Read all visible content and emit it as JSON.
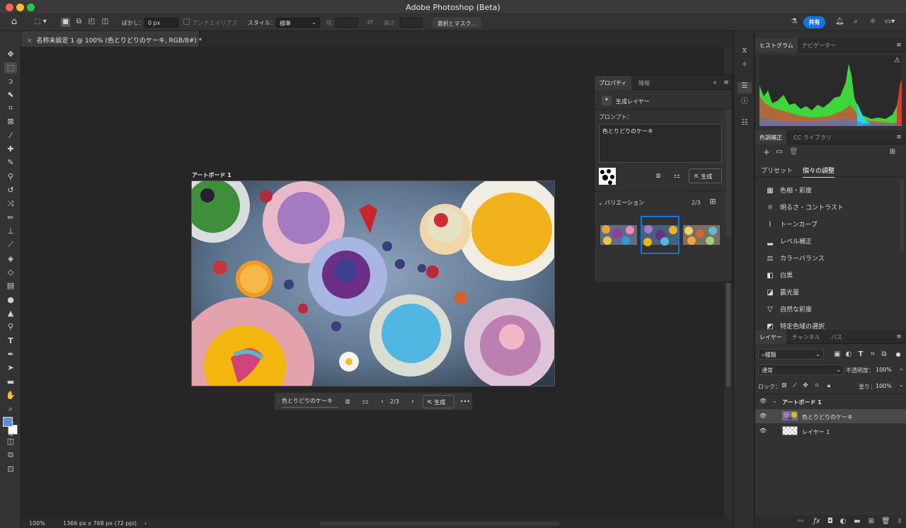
{
  "window": {
    "title": "Adobe Photoshop (Beta)"
  },
  "options_bar": {
    "feather_label": "ぼかし：",
    "feather_value": "0 px",
    "antialias_label": "アンチエイリアス",
    "style_label": "スタイル：",
    "style_value": "標準",
    "width_label": "幅：",
    "height_label": "高さ：",
    "select_mask_button": "選択とマスク...",
    "share_button": "共有"
  },
  "document": {
    "tab_title": "名称未設定 1 @ 100% (色とりどりのケーキ, RGB/8#) *",
    "artboard_label": "アートボード 1"
  },
  "contextual_taskbar": {
    "prompt_text": "色とりどりのケーキ",
    "variation_counter": "2/3",
    "generate_button": "生成",
    "more": "•••"
  },
  "properties_panel": {
    "tabs": [
      "プロパティ",
      "情報"
    ],
    "layer_type": "生成レイヤー",
    "prompt_label": "プロンプト：",
    "prompt_text": "色とりどりのケーキ",
    "generate_button": "生成",
    "variations_label": "バリエーション",
    "variation_counter": "2/3",
    "selected_variation": 2
  },
  "histogram_panel": {
    "tabs": [
      "ヒストグラム",
      "ナビゲーター"
    ]
  },
  "adjustments_panel": {
    "tabs": [
      "色調補正",
      "CC ライブラリ"
    ],
    "subtabs": [
      "プリセット",
      "個々の調整"
    ],
    "items": [
      {
        "icon": "hue-saturation-icon",
        "label": "色相・彩度"
      },
      {
        "icon": "brightness-contrast-icon",
        "label": "明るさ・コントラスト"
      },
      {
        "icon": "curves-icon",
        "label": "トーンカーブ"
      },
      {
        "icon": "levels-icon",
        "label": "レベル補正"
      },
      {
        "icon": "color-balance-icon",
        "label": "カラーバランス"
      },
      {
        "icon": "black-white-icon",
        "label": "白黒"
      },
      {
        "icon": "exposure-icon",
        "label": "露光量"
      },
      {
        "icon": "vibrance-icon",
        "label": "自然な彩度"
      },
      {
        "icon": "selective-color-icon",
        "label": "特定色域の選択"
      }
    ]
  },
  "layers_panel": {
    "tabs": [
      "レイヤー",
      "チャンネル",
      "パス"
    ],
    "filter_kind": "種類",
    "blend_mode": "通常",
    "opacity_label": "不透明度：",
    "opacity_value": "100%",
    "lock_label": "ロック：",
    "fill_label": "塗り：",
    "fill_value": "100%",
    "layers": [
      {
        "name": "アートボード 1",
        "type": "artboard"
      },
      {
        "name": "色とりどりのケーキ",
        "type": "generative",
        "selected": true
      },
      {
        "name": "レイヤー 1",
        "type": "pixel"
      }
    ]
  },
  "status_bar": {
    "zoom": "100%",
    "doc_size": "1366 px x 768 px (72 ppi)"
  },
  "colors": {
    "accent": "#1473e6",
    "foreground_swatch": "#5f8fd8",
    "background_swatch": "#ffffff"
  }
}
